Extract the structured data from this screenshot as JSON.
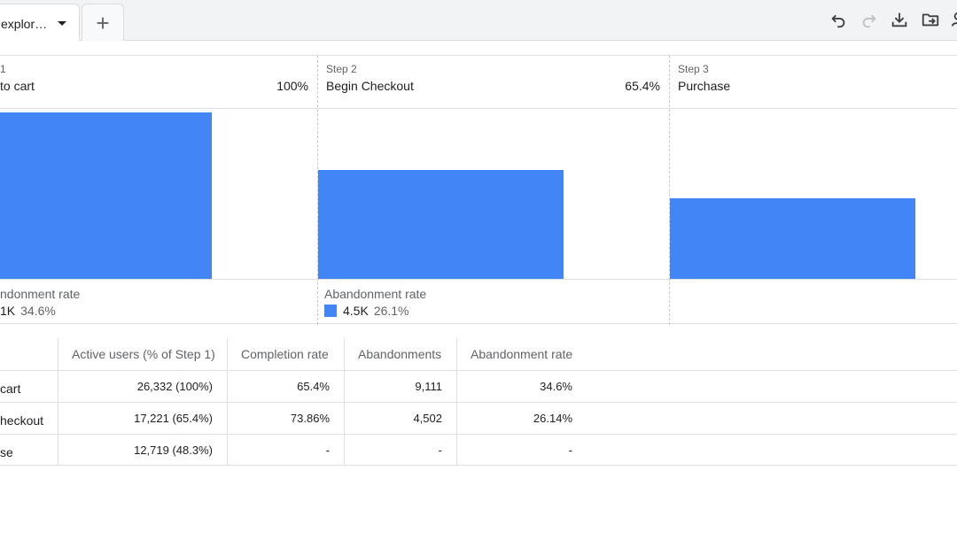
{
  "tabs": {
    "active_label": "explor…",
    "add_label": "+"
  },
  "toolbar": {
    "icons": [
      "undo-icon",
      "redo-icon",
      "download-icon",
      "move-to-folder-icon",
      "share-person-icon"
    ]
  },
  "colors": {
    "bar": "#4285f4",
    "grid": "#e0e0e0",
    "muted_text": "#5f6368"
  },
  "funnel": {
    "steps": [
      {
        "step_label": "1",
        "name": "to cart",
        "percent": "100%",
        "active_users": 26332,
        "abandon_count": "1K",
        "abandon_rate": "34.6%"
      },
      {
        "step_label": "Step 2",
        "name": "Begin Checkout",
        "percent": "65.4%",
        "active_users": 17221,
        "abandon_count": "4.5K",
        "abandon_rate": "26.1%"
      },
      {
        "step_label": "Step 3",
        "name": "Purchase",
        "percent": "",
        "active_users": 12719
      }
    ],
    "abandonment_label_1": "ndonment rate",
    "abandonment_label_2": "Abandonment rate"
  },
  "table": {
    "headers": [
      "Active users (% of Step 1)",
      "Completion rate",
      "Abandonments",
      "Abandonment rate"
    ],
    "rows": [
      {
        "name": "cart",
        "active": "26,332 (100%)",
        "completion": "65.4%",
        "abandonments": "9,111",
        "abandon_rate": "34.6%"
      },
      {
        "name": "heckout",
        "active": "17,221 (65.4%)",
        "completion": "73.86%",
        "abandonments": "4,502",
        "abandon_rate": "26.14%"
      },
      {
        "name": "se",
        "active": "12,719 (48.3%)",
        "completion": "-",
        "abandonments": "-",
        "abandon_rate": "-"
      }
    ]
  },
  "chart_data": {
    "type": "bar",
    "categories": [
      "to cart",
      "Begin Checkout",
      "Purchase"
    ],
    "values": [
      26332,
      17221,
      12719
    ],
    "ylim": [
      0,
      26332
    ],
    "grid": false,
    "title": "",
    "xlabel": "",
    "ylabel": ""
  }
}
